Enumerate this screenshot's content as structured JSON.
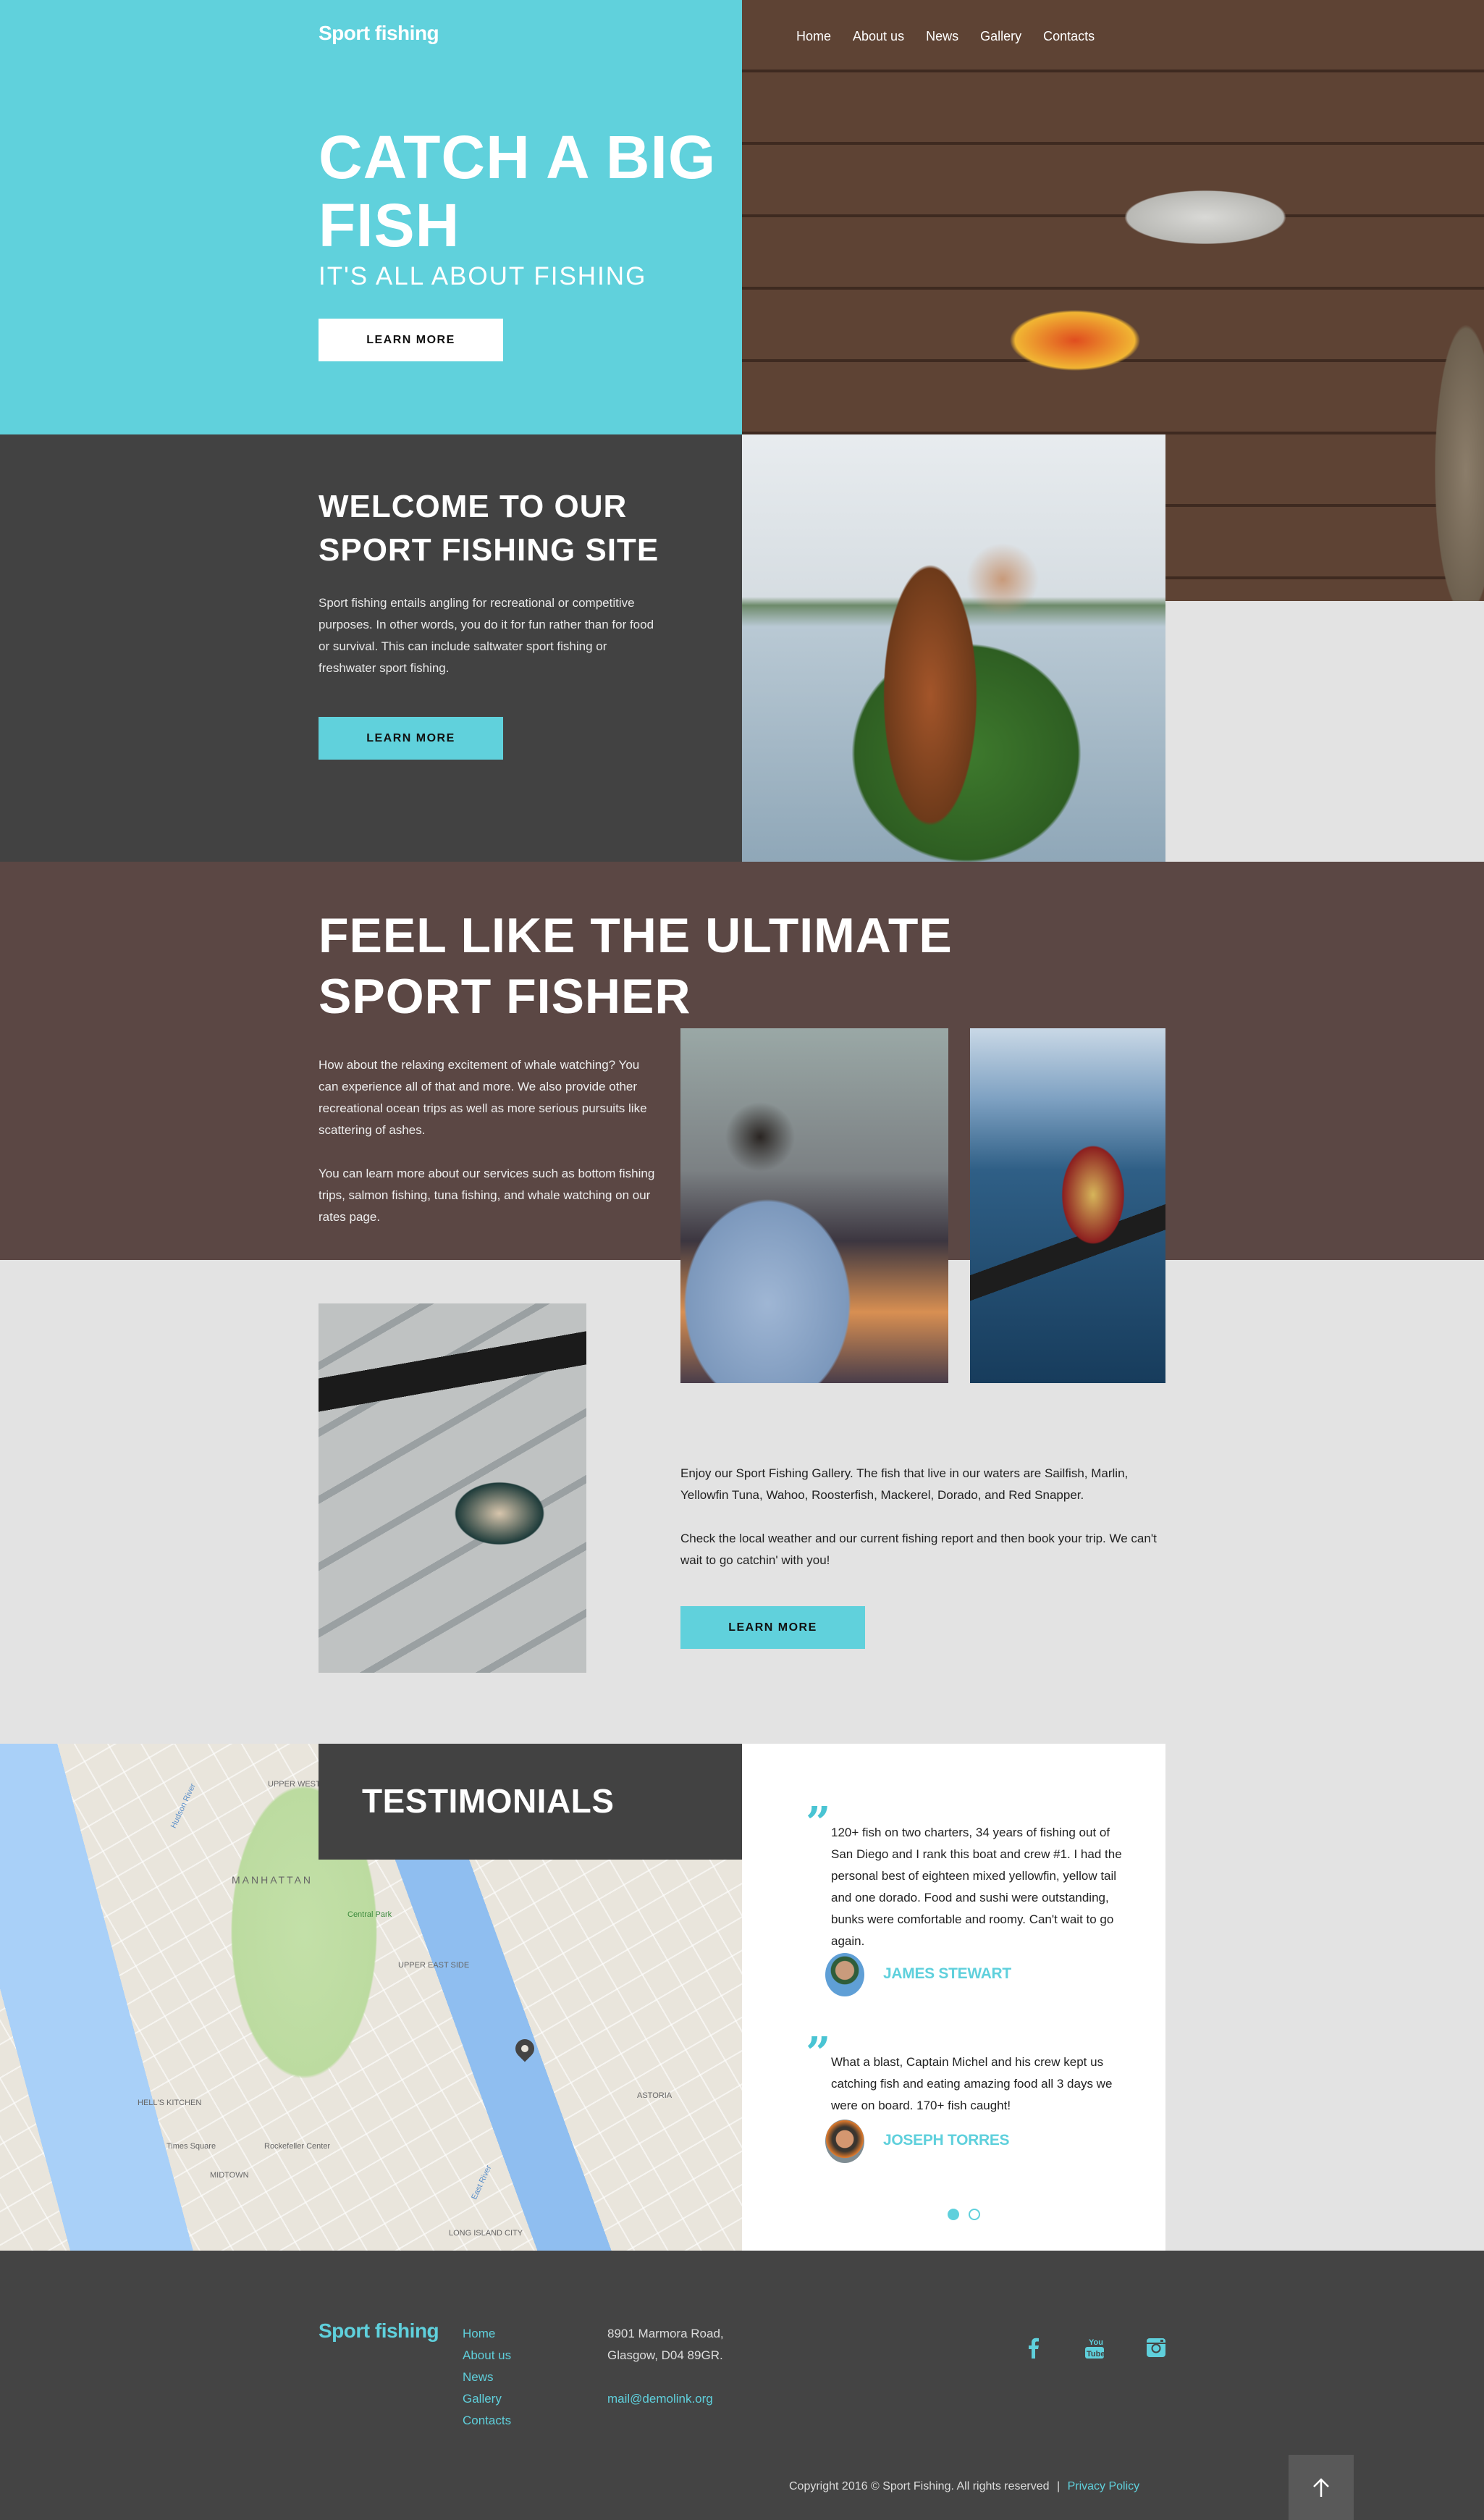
{
  "brand": "Sport fishing",
  "colors": {
    "accent": "#60d1dc",
    "dark": "#424242",
    "brown": "#5b4744",
    "light": "#e3e3e3"
  },
  "nav": [
    "Home",
    "About us",
    "News",
    "Gallery",
    "Contacts"
  ],
  "hero": {
    "title": "CATCH A BIG FISH",
    "subtitle": "IT'S ALL ABOUT FISHING",
    "button": "LEARN MORE"
  },
  "welcome": {
    "title": "WELCOME TO OUR SPORT FISHING SITE",
    "text": "Sport fishing entails angling for recreational or competitive purposes. In other words, you do it for fun rather than for food or survival. This can include saltwater sport fishing or freshwater sport fishing.",
    "button": "LEARN MORE"
  },
  "ultimate": {
    "title": "FEEL LIKE THE ULTIMATE SPORT FISHER",
    "paragraphs": [
      "How about the relaxing excitement of whale watching? You can experience all of that and more. We also provide other recreational ocean trips as well as more serious pursuits like scattering of ashes.",
      "You can learn more about our services such as bottom fishing trips, salmon fishing, tuna fishing, and whale watching on our rates page."
    ]
  },
  "gallery": {
    "paragraphs": [
      "Enjoy our Sport Fishing Gallery. The fish that live in our waters are Sailfish, Marlin, Yellowfin Tuna, Wahoo, Roosterfish, Mackerel, Dorado, and Red Snapper.",
      "Check the local weather and our current fishing report and then book your trip. We can't wait to go catchin' with you!"
    ],
    "button": "LEARN MORE"
  },
  "map": {
    "labels": [
      "MANHATTAN",
      "Central Park",
      "UPPER WEST SIDE",
      "UPPER EAST SIDE",
      "HELL'S KITCHEN",
      "MIDTOWN",
      "ASTORIA",
      "Hudson River",
      "East River",
      "Times Square",
      "Rockefeller Center",
      "LONG ISLAND CITY"
    ]
  },
  "testimonials": {
    "title": "TESTIMONIALS",
    "items": [
      {
        "text": "120+ fish on two charters, 34 years of fishing out of San Diego and I rank this boat and crew #1. I had the personal best of eighteen mixed yellowfin, yellow tail and one dorado. Food and sushi were outstanding, bunks were comfortable and roomy. Can't wait to go again.",
        "author": "JAMES STEWART"
      },
      {
        "text": "What a blast, Captain Michel and his crew kept us catching fish and eating amazing food all 3 days we were on board. 170+ fish caught!",
        "author": "JOSEPH TORRES"
      }
    ],
    "pages": 2,
    "active_page": 1
  },
  "footer": {
    "brand": "Sport fishing",
    "nav": [
      "Home",
      "About us",
      "News",
      "Gallery",
      "Contacts"
    ],
    "address_line1": "8901 Marmora Road,",
    "address_line2": "Glasgow, D04 89GR.",
    "email": "mail@demolink.org",
    "social": [
      "facebook-icon",
      "youtube-icon",
      "instagram-icon"
    ],
    "copyright": "Copyright 2016 © Sport Fishing. All rights reserved",
    "separator": "|",
    "privacy": "Privacy Policy"
  }
}
